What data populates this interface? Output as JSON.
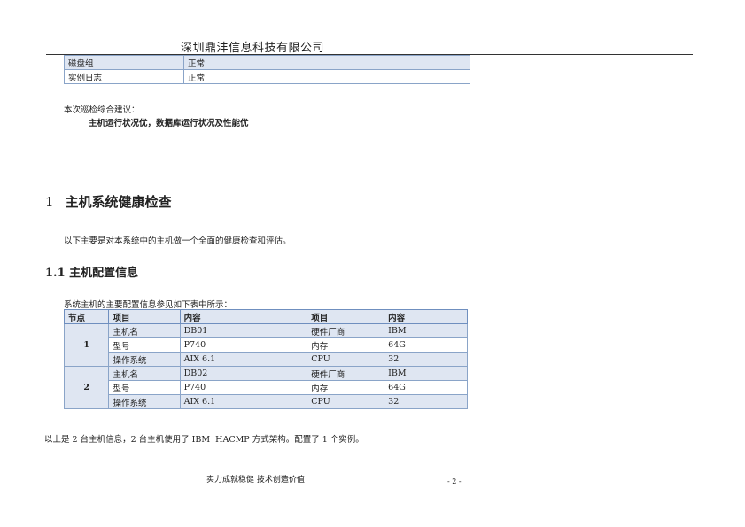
{
  "header": {
    "company": "深圳鼎沣信息科技有限公司"
  },
  "status_rows": [
    {
      "item": "磁盘组",
      "status": "正常"
    },
    {
      "item": "实例日志",
      "status": "正常"
    }
  ],
  "suggestion": {
    "label": "本次巡检综合建议：",
    "text": "主机运行状况优，数据库运行状况及性能优"
  },
  "section1": {
    "number": "1",
    "title": "主机系统健康检查",
    "intro": "以下主要是对本系统中的主机做一个全面的健康检查和评估。"
  },
  "section1_1": {
    "title": "1.1 主机配置信息",
    "intro": "系统主机的主要配置信息参见如下表中所示："
  },
  "config_table": {
    "headers": [
      "节点",
      "项目",
      "内容",
      "项目",
      "内容"
    ],
    "nodes": [
      {
        "node": "1",
        "rows": [
          [
            "主机名",
            "DB01",
            "硬件厂商",
            "IBM"
          ],
          [
            "型号",
            "P740",
            "内存",
            "64G"
          ],
          [
            "操作系统",
            "AIX 6.1",
            "CPU",
            "32"
          ]
        ]
      },
      {
        "node": "2",
        "rows": [
          [
            "主机名",
            "DB02",
            "硬件厂商",
            "IBM"
          ],
          [
            "型号",
            "P740",
            "内存",
            "64G"
          ],
          [
            "操作系统",
            "AIX 6.1",
            "CPU",
            "32"
          ]
        ]
      }
    ]
  },
  "summary": "以上是 2 台主机信息，2 台主机使用了 IBM  HACMP 方式架构。配置了 1 个实例。",
  "footer": {
    "motto": "实力成就稳健  技术创造价值",
    "page": "- 2 -"
  }
}
